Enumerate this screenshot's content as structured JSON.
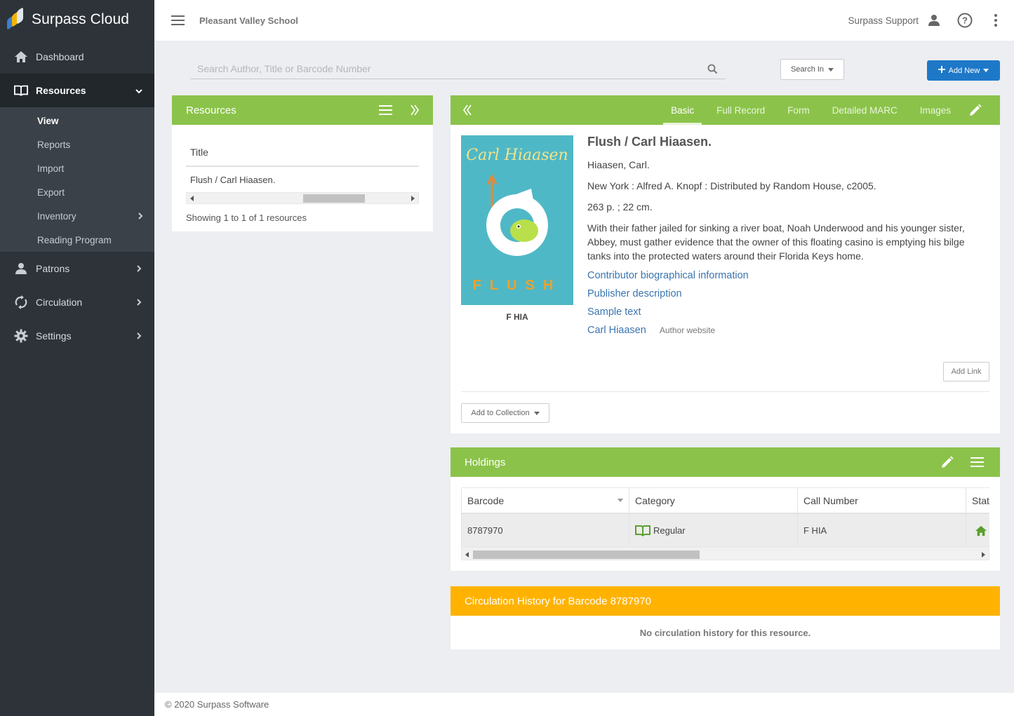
{
  "app": {
    "name": "Surpass Cloud",
    "school": "Pleasant Valley School",
    "user": "Surpass Support",
    "colors": {
      "accent_green": "#8bc34a",
      "primary_blue": "#1e78c8",
      "circ_orange": "#ffb300",
      "sidebar": "#2d3339",
      "link": "#3a75b0"
    }
  },
  "sidebar": {
    "items": [
      {
        "label": "Dashboard",
        "icon": "home-icon"
      },
      {
        "label": "Resources",
        "icon": "book-icon"
      },
      {
        "label": "Patrons",
        "icon": "person-icon"
      },
      {
        "label": "Circulation",
        "icon": "sync-icon"
      },
      {
        "label": "Settings",
        "icon": "gear-icon"
      }
    ],
    "resources_sub": [
      {
        "label": "View"
      },
      {
        "label": "Reports"
      },
      {
        "label": "Import"
      },
      {
        "label": "Export"
      },
      {
        "label": "Inventory"
      },
      {
        "label": "Reading Program"
      }
    ]
  },
  "toolbar": {
    "search_placeholder": "Search Author, Title or Barcode Number",
    "search_in_label": "Search In",
    "add_new_label": "Add New"
  },
  "resources_panel": {
    "title": "Resources",
    "column_title": "Title",
    "rows": [
      "Flush / Carl Hiaasen."
    ],
    "showing": "Showing 1 to 1 of 1 resources"
  },
  "detail": {
    "tabs": [
      "Basic",
      "Full Record",
      "Form",
      "Detailed MARC",
      "Images"
    ],
    "active_tab": "Basic",
    "cover": {
      "author_text": "Carl Hiaasen",
      "title_text": "FLUSH"
    },
    "call_number": "F HIA",
    "title": "Flush / Carl Hiaasen.",
    "author": "Hiaasen, Carl.",
    "publication": "New York : Alfred A. Knopf : Distributed by Random House, c2005.",
    "physical": "263 p. ; 22 cm.",
    "summary": "With their father jailed for sinking a river boat, Noah Underwood and his younger sister, Abbey, must gather evidence that the owner of this floating casino is emptying his bilge tanks into the protected waters around their Florida Keys home.",
    "links": [
      {
        "text": "Contributor biographical information",
        "note": ""
      },
      {
        "text": "Publisher description",
        "note": ""
      },
      {
        "text": "Sample text",
        "note": ""
      },
      {
        "text": "Carl Hiaasen",
        "note": "Author website"
      }
    ],
    "add_link_label": "Add Link",
    "add_collection_label": "Add to Collection"
  },
  "holdings": {
    "title": "Holdings",
    "columns": [
      "Barcode",
      "Category",
      "Call Number",
      "Stat"
    ],
    "rows": [
      {
        "barcode": "8787970",
        "category": "Regular",
        "call_number": "F HIA",
        "status_icon": "home-icon"
      }
    ]
  },
  "circulation": {
    "title": "Circulation History for Barcode 8787970",
    "empty_message": "No circulation history for this resource."
  },
  "footer": {
    "text": "© 2020 Surpass Software"
  }
}
